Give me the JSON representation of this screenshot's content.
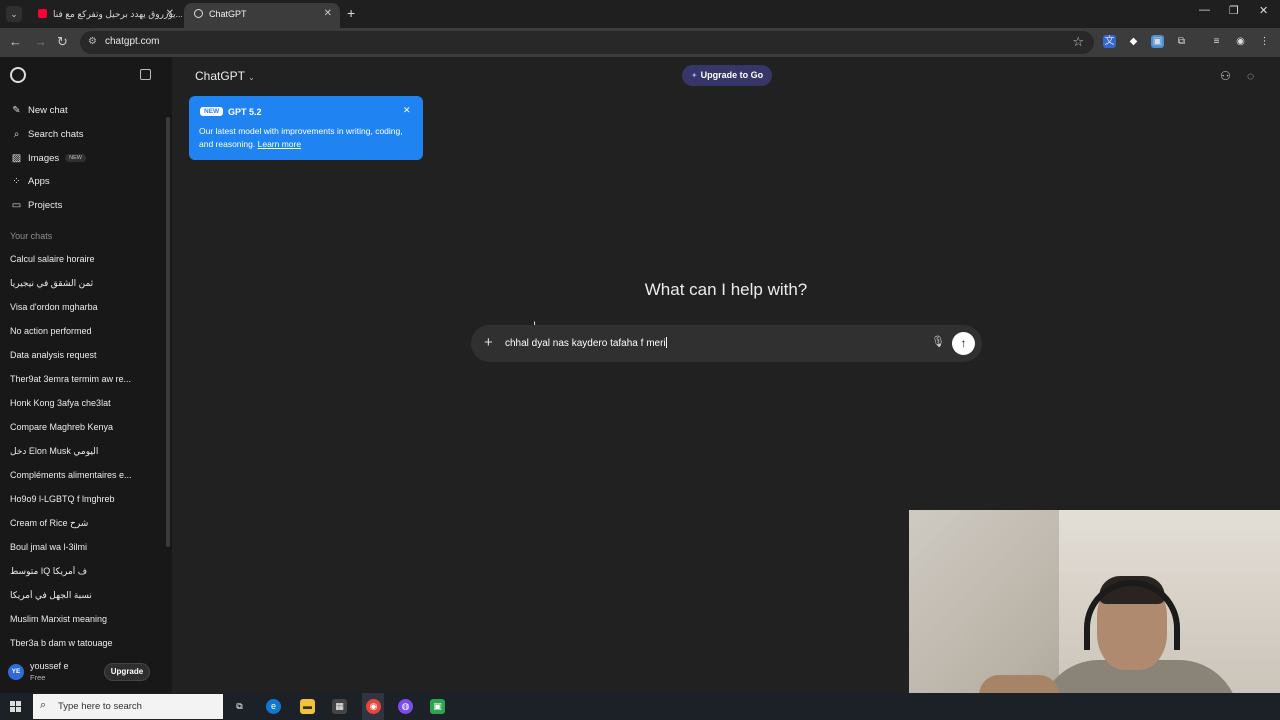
{
  "browser": {
    "tabs": [
      {
        "title": "يوزروق يهدد برحيل وتفركع مع فنا...",
        "active": false
      },
      {
        "title": "ChatGPT",
        "active": true
      }
    ],
    "url": "chatgpt.com"
  },
  "sidebar": {
    "nav": [
      {
        "label": "New chat",
        "icon": "edit-icon"
      },
      {
        "label": "Search chats",
        "icon": "search-icon"
      },
      {
        "label": "Images",
        "icon": "image-icon",
        "badge": "NEW"
      },
      {
        "label": "Apps",
        "icon": "apps-icon"
      },
      {
        "label": "Projects",
        "icon": "folder-icon"
      }
    ],
    "section_title": "Your chats",
    "chats": [
      "Calcul salaire horaire",
      "ثمن الشقق في نيجيريا",
      "Visa d'ordon mgharba",
      "No action performed",
      "Data analysis request",
      "Ther9at 3emra termim aw re...",
      "Honk Kong 3afya che3lat",
      "Compare Maghreb Kenya",
      "دخل Elon Musk اليومي",
      "Compléments alimentaires e...",
      "Ho9o9 l-LGBTQ f lmghreb",
      "Cream of Rice شرح",
      "Boul jmal wa l-3ilmi",
      "متوسط IQ ف أمريكا",
      "نسبة الجهل في أمريكا",
      "Muslim Marxist meaning",
      "Tber3a b dam w tatouage"
    ],
    "user": {
      "initials": "YE",
      "name": "youssef e",
      "plan": "Free"
    },
    "upgrade_label": "Upgrade"
  },
  "header": {
    "model": "ChatGPT",
    "upgrade_go": "Upgrade to Go"
  },
  "tooltip": {
    "badge": "NEW",
    "title": "GPT 5.2",
    "body": "Our latest model with improvements in writing, coding, and reasoning.",
    "link": "Learn more"
  },
  "main": {
    "heading": "What can I help with?",
    "input_value": "chhal dyal nas kaydero tafaha f meri"
  },
  "taskbar": {
    "search_placeholder": "Type here to search"
  },
  "colors": {
    "accent_blue": "#1f84f2",
    "upgrade_purple": "#373669",
    "background": "#212121",
    "sidebar": "#181818"
  }
}
